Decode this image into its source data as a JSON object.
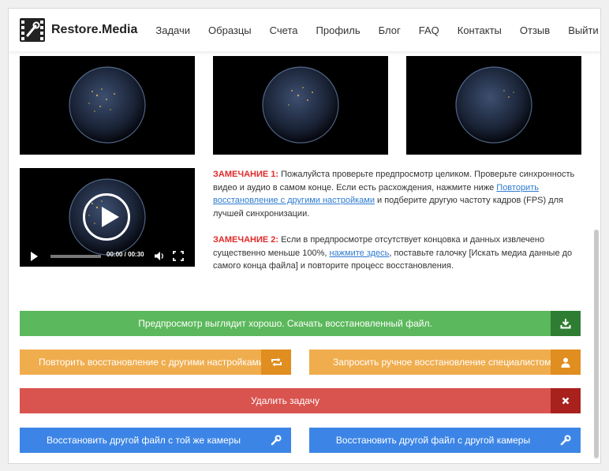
{
  "brand": {
    "name": "Restore.Media"
  },
  "nav": [
    {
      "label": "Задачи"
    },
    {
      "label": "Образцы"
    },
    {
      "label": "Счета"
    },
    {
      "label": "Профиль"
    },
    {
      "label": "Блог"
    },
    {
      "label": "FAQ"
    },
    {
      "label": "Контакты"
    },
    {
      "label": "Отзыв"
    },
    {
      "label": "Выйти"
    }
  ],
  "video": {
    "time": "00:00 / 00:30"
  },
  "notes": {
    "note1": {
      "label": "ЗАМЕЧАНИЕ 1:",
      "text1": " Пожалуйста проверьте предпросмотр целиком. Проверьте синхронность видео и аудио в самом конце. Если есть расхождения, нажмите ниже ",
      "link": "Повторить восстановление с другими настройками",
      "text2": " и подберите другую частоту кадров (FPS) для лучшей синхронизации."
    },
    "note2": {
      "label": "ЗАМЕЧАНИЕ 2:",
      "text1": " Если в предпросмотре отсутствует концовка и данных извлечено существенно меньше 100%, ",
      "link": "нажмите здесь",
      "text2": ", поставьте галочку [Искать медиа данные до самого конца файла] и повторите процесс восстановления."
    }
  },
  "buttons": {
    "download": "Предпросмотр выглядит хорошо. Скачать восстановленный файл.",
    "retry": "Повторить восстановление с другими настройками",
    "manual": "Запросить ручное восстановление специалистом",
    "delete": "Удалить задачу",
    "same_camera": "Восстановить другой файл с той же камеры",
    "other_camera": "Восстановить другой файл с другой камеры"
  },
  "colors": {
    "green": "#5cb85c",
    "orange": "#f0ad4e",
    "red": "#d9534f",
    "blue": "#3c85e6",
    "note_label": "#e02a2a",
    "link": "#2e7bcf"
  },
  "icons": {
    "logo": "film-wrench-icon",
    "download": "download-icon",
    "retry": "repeat-icon",
    "manual": "user-icon",
    "delete": "close-icon",
    "same_camera": "wrench-icon",
    "other_camera": "wrench-icon",
    "play": "play-icon",
    "volume": "volume-icon",
    "fullscreen": "fullscreen-icon"
  }
}
